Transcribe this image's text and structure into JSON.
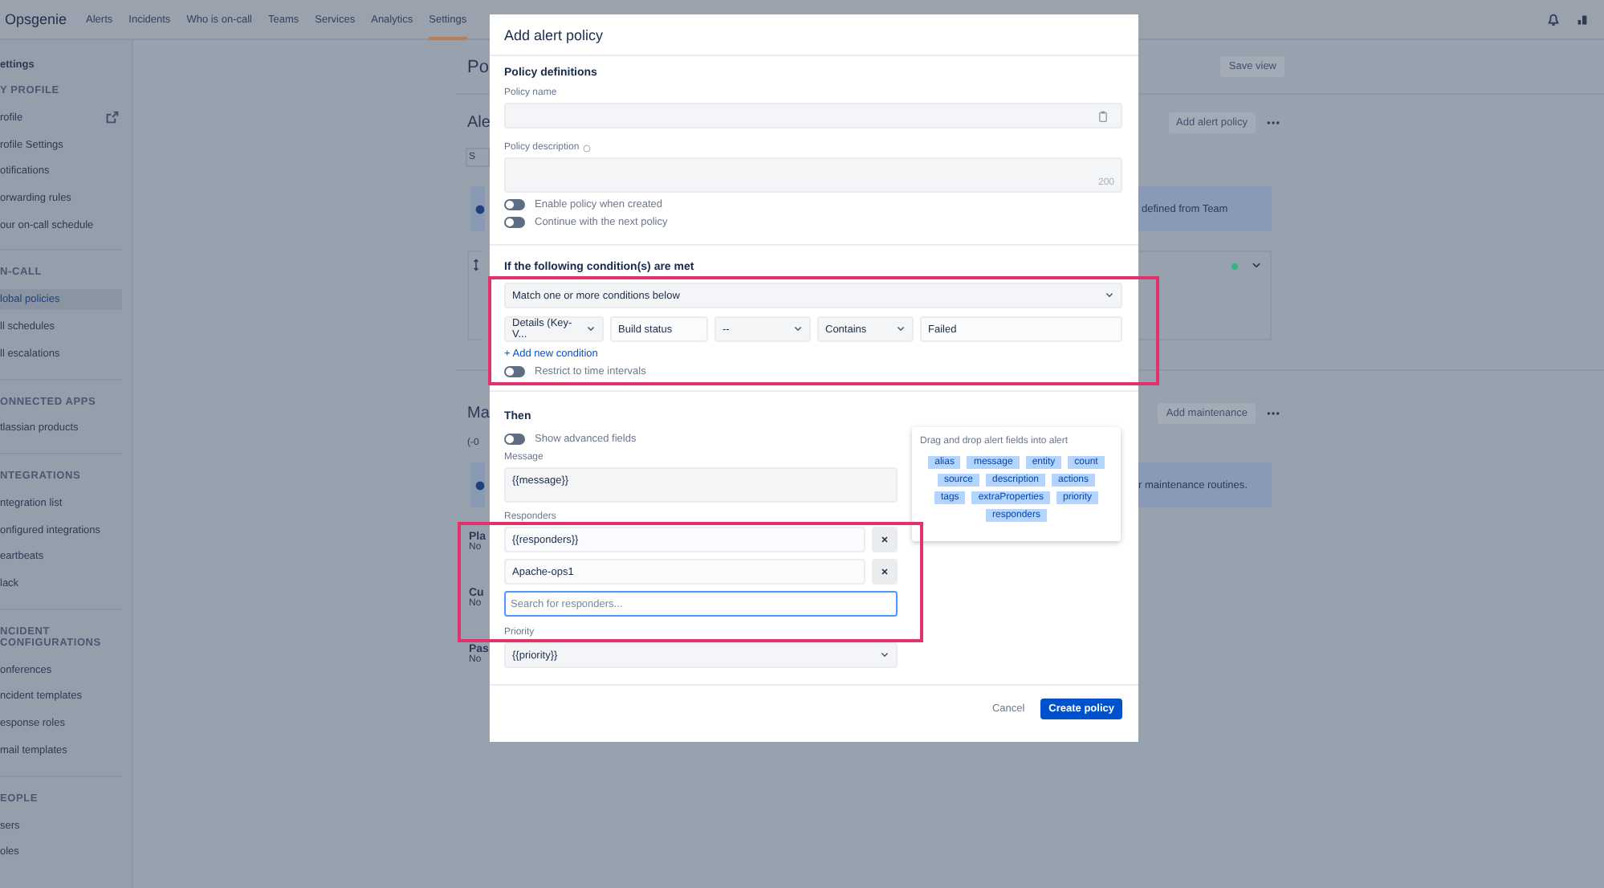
{
  "top_nav": {
    "logo": "Opsgenie",
    "tabs": [
      {
        "label": "Alerts",
        "selected": false
      },
      {
        "label": "Incidents",
        "selected": false
      },
      {
        "label": "Who is on-call",
        "selected": false
      },
      {
        "label": "Teams",
        "selected": false
      },
      {
        "label": "Services",
        "selected": false
      },
      {
        "label": "Analytics",
        "selected": false
      },
      {
        "label": "Settings",
        "selected": true
      }
    ]
  },
  "sidebar": {
    "title": "ettings",
    "sections": [
      {
        "heading": "Y PROFILE",
        "items": [
          {
            "label": "rofile",
            "kind": "external",
            "selected": false
          },
          {
            "label": "rofile Settings",
            "kind": "link",
            "selected": false
          },
          {
            "label": "otifications",
            "kind": "link",
            "selected": false
          },
          {
            "label": "orwarding rules",
            "kind": "link",
            "selected": false
          },
          {
            "label": "our on-call schedule",
            "kind": "link",
            "selected": false
          }
        ]
      },
      {
        "heading": "N-CALL",
        "items": [
          {
            "label": "lobal policies",
            "selected": true
          },
          {
            "label": "ll schedules",
            "selected": false
          },
          {
            "label": "ll escalations",
            "selected": false
          }
        ]
      },
      {
        "heading": "ONNECTED APPS",
        "items": [
          {
            "label": "tlassian products",
            "selected": false
          }
        ]
      },
      {
        "heading": "NTEGRATIONS",
        "items": [
          {
            "label": "ntegration list",
            "selected": false
          },
          {
            "label": "onfigured integrations",
            "selected": false
          },
          {
            "label": "eartbeats",
            "selected": false
          },
          {
            "label": "lack",
            "selected": false
          }
        ]
      },
      {
        "heading": "NCIDENT CONFIGURATIONS",
        "items": [
          {
            "label": "onferences",
            "selected": false
          },
          {
            "label": "ncident templates",
            "selected": false
          },
          {
            "label": "esponse roles",
            "selected": false
          },
          {
            "label": "mail templates",
            "selected": false
          }
        ]
      },
      {
        "heading": "EOPLE",
        "items": [
          {
            "label": "sers",
            "selected": false
          },
          {
            "label": "oles",
            "selected": false
          }
        ]
      }
    ]
  },
  "page": {
    "title": "Po",
    "save_view": "Save view",
    "alert_policies": {
      "title": "Ale",
      "search": "S",
      "add_button": "Add alert policy",
      "info": "defined from Team",
      "card": {
        "enabled": true
      }
    },
    "maintenance": {
      "title": "Ma",
      "subtitle": "(-0",
      "add_button": "Add maintenance",
      "info": "r maintenance routines.",
      "groups": [
        {
          "title": "Pla",
          "text": "No"
        },
        {
          "title": "Cu",
          "text": "No"
        },
        {
          "title": "Pas",
          "text": "No"
        }
      ]
    }
  },
  "modal": {
    "title": "Add alert policy",
    "definitions": {
      "heading": "Policy definitions",
      "name_label": "Policy name",
      "description_label": "Policy description",
      "char_count": "200",
      "toggles": [
        {
          "label": "Enable policy when created",
          "on": false
        },
        {
          "label": "Continue with the next policy",
          "on": false
        }
      ]
    },
    "conditions": {
      "heading": "If the following condition(s) are met",
      "match": "Match one or more conditions below",
      "row": [
        {
          "kind": "select",
          "value": "Details (Key-V..."
        },
        {
          "kind": "input",
          "value": "Build status"
        },
        {
          "kind": "select",
          "value": "--"
        },
        {
          "kind": "select",
          "value": "Contains"
        },
        {
          "kind": "input",
          "value": "Failed"
        }
      ],
      "add_condition": "+ Add new condition",
      "time_toggle": {
        "label": "Restrict to time intervals",
        "on": false
      }
    },
    "then": {
      "heading": "Then",
      "advanced_toggle": {
        "label": "Show advanced fields",
        "on": false
      },
      "message_label": "Message",
      "message": "{{message}}",
      "responders_label": "Responders",
      "responders": [
        "{{responders}}",
        "Apache-ops1"
      ],
      "responder_search": {
        "placeholder": "Search for responders..."
      },
      "priority_label": "Priority",
      "priority": "{{priority}}",
      "fields_panel": {
        "title": "Drag and drop alert fields into alert",
        "chips": [
          [
            "alias",
            "message",
            "entity",
            "count"
          ],
          [
            "source",
            "description",
            "actions"
          ],
          [
            "tags",
            "extraProperties",
            "priority"
          ],
          [
            "responders"
          ]
        ]
      }
    },
    "buttons": {
      "cancel": "Cancel",
      "create": "Create policy"
    }
  }
}
